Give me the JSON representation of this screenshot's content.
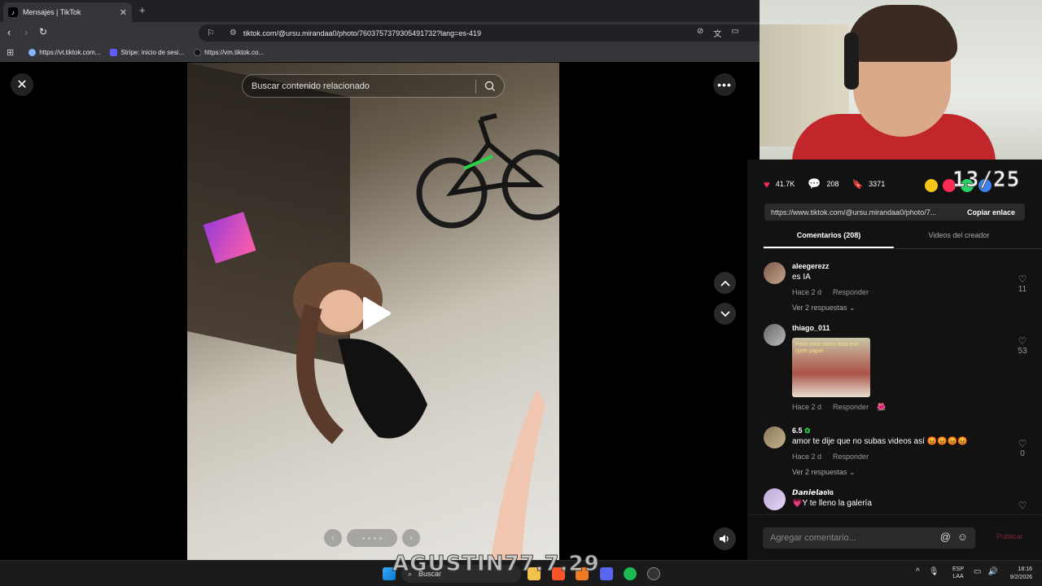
{
  "browser": {
    "tab_title": "Mensajes | TikTok",
    "url": "tiktok.com/@ursu.mirandaa0/photo/7603757379305491732?lang=es-419",
    "bookmarks": [
      {
        "label": "https://vt.tiktok.com...",
        "color": "#8ab4f8"
      },
      {
        "label": "Stripe: inicio de sesi...",
        "color": "#635bff"
      },
      {
        "label": "https://vm.tiktok.co...",
        "color": "#000000"
      }
    ]
  },
  "viewer": {
    "search_placeholder": "Buscar contenido relacionado",
    "slide_count_dots": 4
  },
  "stats": {
    "likes": "41.7K",
    "comments": "208",
    "saves": "3371",
    "overlay_count": "13/25"
  },
  "share": {
    "link": "https://www.tiktok.com/@ursu.mirandaa0/photo/7...",
    "copy_label": "Copiar enlace"
  },
  "tabs": {
    "comments": "Comentarios (208)",
    "creator_videos": "Videos del creador"
  },
  "comments": [
    {
      "user": "aleegerezz",
      "text": "es IA",
      "time": "Hace 2 d",
      "reply": "Responder",
      "replies": "Ver 2 respuestas",
      "likes": "11"
    },
    {
      "user": "thiago_011",
      "text": "",
      "sticker_caption": "Pero mira como esta ese ojete papá!",
      "time": "Hace 2 d",
      "reply": "Responder",
      "likes": "53"
    },
    {
      "user": "6.5",
      "text": "amor te dije que no subas videos así 😡😡😡😡",
      "time": "Hace 2 d",
      "reply": "Responder",
      "replies": "Ver 2 respuestas",
      "likes": "0"
    },
    {
      "user": "𝘿𝙖𝙣𝙞𝙚𝙡𝙖ʚĭɞ",
      "text": "💗Y te lleno la galería",
      "likes": ""
    }
  ],
  "comment_input": {
    "placeholder": "Agregar comentario...",
    "publish_label": "Publicar"
  },
  "taskbar": {
    "search_label": "Buscar",
    "watermark": "AGUSTIN77.7.29",
    "lang_top": "ESP",
    "lang_bottom": "LAA",
    "time": "18:16",
    "date": "9/2/2026"
  }
}
